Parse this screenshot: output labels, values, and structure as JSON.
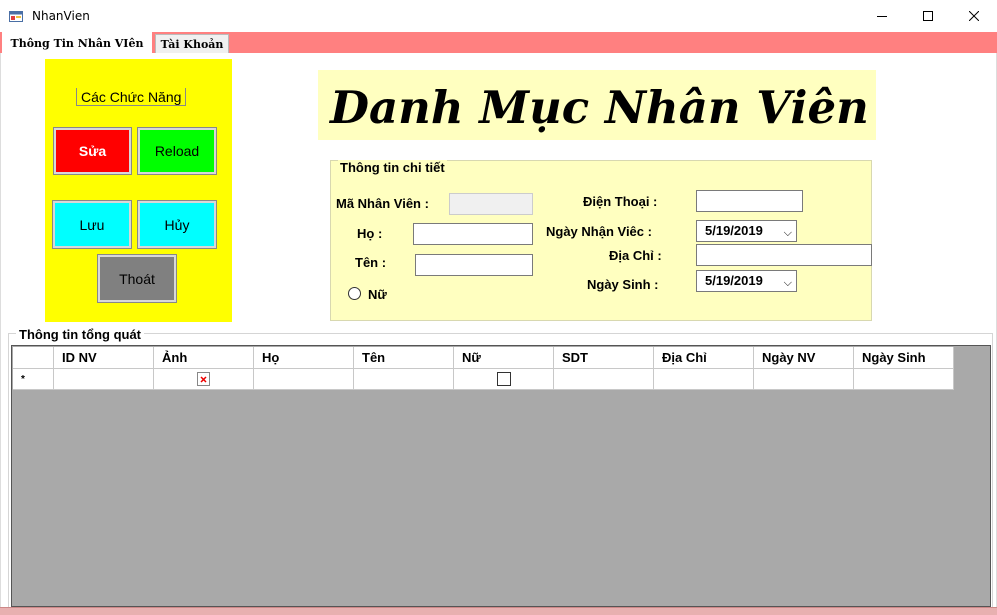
{
  "window": {
    "title": "NhanVien"
  },
  "tabs": [
    {
      "label": "Thông Tin Nhân VIên"
    },
    {
      "label": "Tài Khoản"
    }
  ],
  "functions": {
    "group_label": "Các Chức Năng",
    "buttons": {
      "sua": "Sửa",
      "reload": "Reload",
      "luu": "Lưu",
      "huy": "Hủy",
      "thoat": "Thoát"
    }
  },
  "heading": "Danh Mục Nhân Viên",
  "details": {
    "title": "Thông tin chi tiết",
    "labels": {
      "ma_nv": "Mã Nhân Viên :",
      "ho": "Họ :",
      "ten": "Tên :",
      "nu": "Nữ",
      "dien_thoai": "Điện Thoại :",
      "ngay_nhan_viec": "Ngày Nhận Viêc :",
      "dia_chi": "Địa Chỉ :",
      "ngay_sinh": "Ngày Sinh :"
    },
    "values": {
      "ma_nv": "",
      "ho": "",
      "ten": "",
      "dien_thoai": "",
      "ngay_nhan_viec": "5/19/2019",
      "dia_chi": "",
      "ngay_sinh": "5/19/2019"
    }
  },
  "general": {
    "title": "Thông tin tổng quát",
    "columns": [
      "ID NV",
      "Ảnh",
      "Họ",
      "Tên",
      "Nữ",
      "SDT",
      "Địa Chỉ",
      "Ngày NV",
      "Ngày Sinh"
    ],
    "new_row_marker": "*"
  },
  "colors": {
    "tab_strip": "#ff8080",
    "panel_yellow": "#ffff00",
    "details_bg": "#ffffc0",
    "btn_sua": "#ff0000",
    "btn_reload": "#00ff00",
    "btn_luu_huy": "#00ffff",
    "btn_thoat": "#808080",
    "grid_bg": "#a9a9a9"
  }
}
